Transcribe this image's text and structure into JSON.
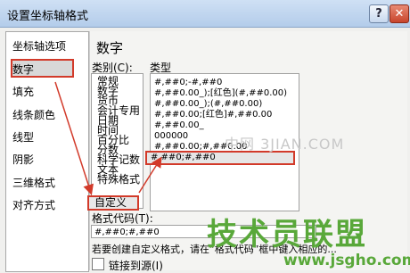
{
  "window": {
    "title": "设置坐标轴格式",
    "help_label": "?",
    "close_label": "✕"
  },
  "nav": {
    "items": [
      "坐标轴选项",
      "数字",
      "填充",
      "线条颜色",
      "线型",
      "阴影",
      "三维格式",
      "对齐方式"
    ],
    "selected": "数字"
  },
  "panel": {
    "heading": "数字",
    "category_label": "类别(C):",
    "type_label": "类型",
    "categories": [
      "常规",
      "数字",
      "货币",
      "会计专用",
      "日期",
      "时间",
      "百分比",
      "分数",
      "科学记数",
      "文本",
      "特殊格式",
      "自定义"
    ],
    "selected_category": "自定义",
    "types": [
      "#,##0;-#,##0",
      "#,##0.00_);[红色](#,##0.00)",
      "#,##0.00_);(#,##0.00)",
      "#,##0.00;[红色]#,##0.00",
      "#,##0.00_",
      "000000",
      "#,##0.00;#,##0.00",
      "#,##0;#,##0"
    ],
    "selected_type": "#,##0;#,##0",
    "format_code_label": "格式代码(T):",
    "format_code_value": "#,##0;#,##0",
    "hint": "若要创建自定义格式，请在“格式代码”框中键入相应的...",
    "link_checkbox_label": "链接到源(I)"
  },
  "watermark": {
    "site": "中网 3JIAN.COM",
    "logo": "技术员联盟",
    "url": "www.jsgho.com"
  },
  "colors": {
    "highlight": "#d23a2a",
    "titlebar": "#b3ccea",
    "watermark_green": "#59a83a"
  }
}
